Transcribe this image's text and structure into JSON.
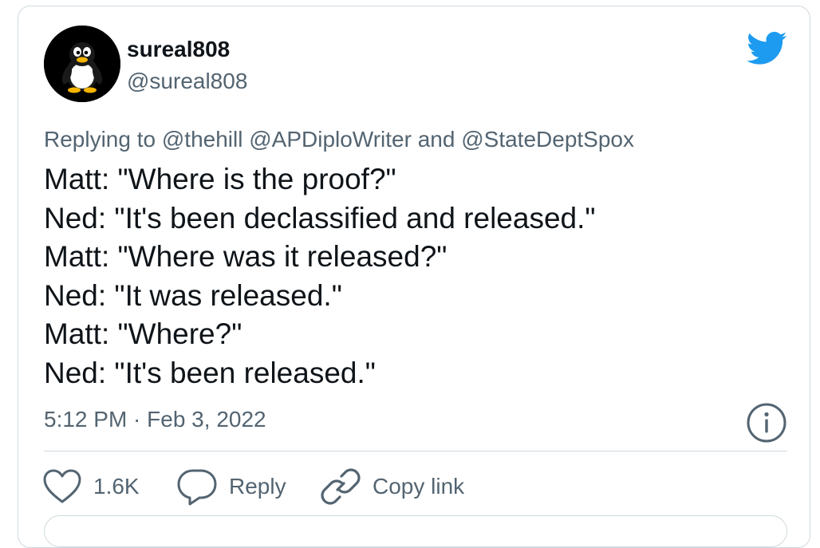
{
  "user": {
    "name": "sureal808",
    "handle": "@sureal808"
  },
  "tweet": {
    "replying_to": "Replying to @thehill @APDiploWriter and @StateDeptSpox",
    "lines": [
      "Matt: \"Where is the proof?\"",
      "Ned: \"It's been declassified and released.\"",
      "Matt: \"Where was it released?\"",
      "Ned: \"It was released.\"",
      "Matt: \"Where?\"",
      "Ned: \"It's been released.\""
    ],
    "timestamp": "5:12 PM · Feb 3, 2022"
  },
  "actions": {
    "like_count": "1.6K",
    "reply_label": "Reply",
    "copy_link_label": "Copy link"
  },
  "icons": {
    "brand": "twitter-bird-icon",
    "info": "info-icon",
    "like": "heart-icon",
    "reply": "speech-bubble-icon",
    "copy": "link-icon"
  },
  "colors": {
    "brand_blue": "#1d9bf0",
    "text_primary": "#0f1419",
    "text_secondary": "#536471",
    "border": "#cfd9de"
  }
}
